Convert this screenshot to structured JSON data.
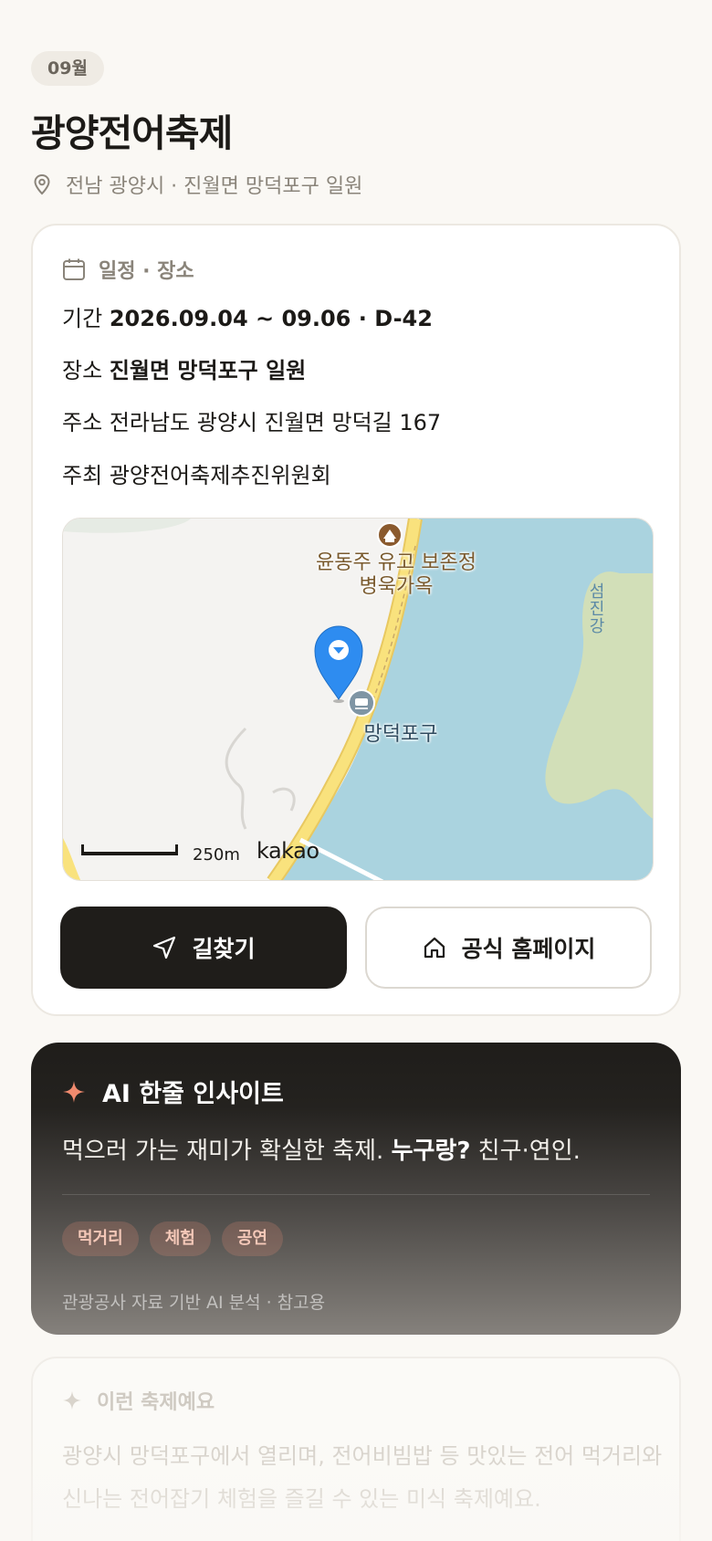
{
  "header": {
    "month_badge": "09월",
    "title": "광양전어축제",
    "location": "전남 광양시 · 진월면 망덕포구 일원"
  },
  "info_card": {
    "heading": "일정 · 장소",
    "period_label": "기간",
    "period_value": "2026.09.04 ~ 09.06 · D-42",
    "venue_label": "장소",
    "venue_value": "진월면 망덕포구 일원",
    "address_label": "주소",
    "address_value": "전라남도 광양시 진월면 망덕길 167",
    "host_label": "주최",
    "host_value": "광양전어축제추진위원회",
    "map": {
      "poi_label": "윤동주 유고 보존정병욱가옥",
      "river_label": "섬진강",
      "port_label": "망덕포구",
      "scale_label": "250m",
      "logo": "kakao",
      "colors": {
        "water": "#aad3df",
        "land": "#f4f3f1",
        "island": "#d2dfb8",
        "road": "#f9e27d",
        "pin": "#2e8cf0"
      }
    },
    "directions_button": "길찾기",
    "homepage_button": "공식 홈페이지"
  },
  "ai_insight": {
    "heading": "AI 한줄 인사이트",
    "text_lead": "먹으러 가는 재미가 확실한 축제.",
    "text_bold": "누구랑?",
    "text_tail": "친구·연인.",
    "tags": [
      "먹거리",
      "체험",
      "공연"
    ],
    "note": "관광공사 자료 기반 AI 분석 · 참고용"
  },
  "description": {
    "heading": "이런 축제예요",
    "text": "광양시 망덕포구에서 열리며, 전어비빔밥 등 맛있는 전어 먹거리와 신나는 전어잡기 체험을 즐길 수 있는 미식 축제예요."
  },
  "colors": {
    "background": "#faf8f4",
    "primary_button": "#1f1d1a",
    "ai_accent": "#f08a6e"
  }
}
